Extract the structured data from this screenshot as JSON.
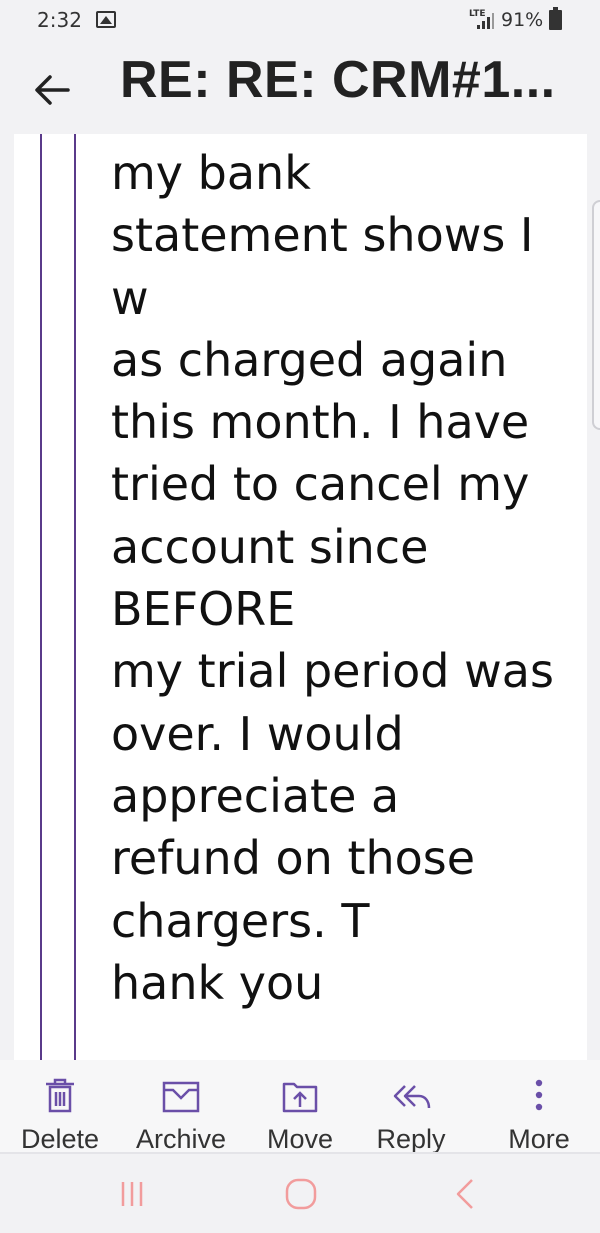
{
  "status": {
    "time": "2:32",
    "network": "LTE",
    "battery": "91%"
  },
  "header": {
    "title": "RE: RE: CRM#1..."
  },
  "message": {
    "lines": [
      "my bank",
      "statement shows I",
      "w",
      "as charged again",
      "this month. I have",
      "tried to cancel my",
      "account since",
      "BEFORE",
      "my trial period was",
      "over. I would",
      "appreciate a",
      "refund on those",
      "chargers. T",
      "hank you"
    ]
  },
  "toolbar": {
    "delete_label": "Delete",
    "archive_label": "Archive",
    "move_label": "Move",
    "reply_label": "Reply",
    "more_label": "More"
  },
  "colors": {
    "accent": "#6a4fa8",
    "quote_bar": "#5a3a8a",
    "nav_icon": "#f29c9c"
  }
}
